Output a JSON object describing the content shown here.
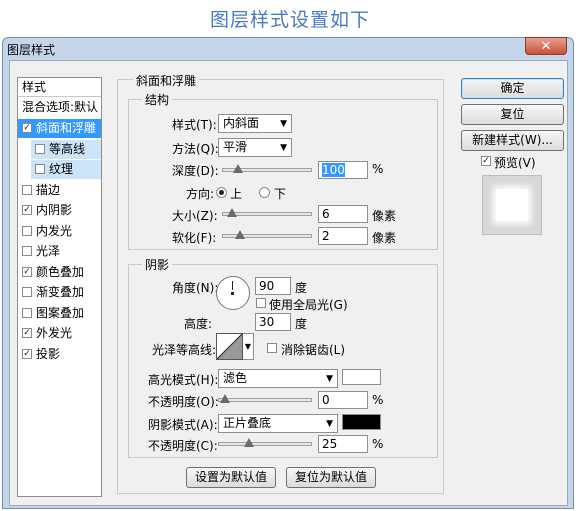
{
  "banner": {
    "text": "图层样式设置如下"
  },
  "window": {
    "title": "图层样式",
    "close_symbol": "✕"
  },
  "left_panel": {
    "header": "样式",
    "blend": "混合选项:默认",
    "items": [
      {
        "label": "斜面和浮雕",
        "checked": true,
        "selected": true,
        "sub": false
      },
      {
        "label": "等高线",
        "checked": false,
        "selected": false,
        "sub": true
      },
      {
        "label": "纹理",
        "checked": false,
        "selected": false,
        "sub": true
      },
      {
        "label": "描边",
        "checked": false,
        "selected": false,
        "sub": false
      },
      {
        "label": "内阴影",
        "checked": true,
        "selected": false,
        "sub": false
      },
      {
        "label": "内发光",
        "checked": false,
        "selected": false,
        "sub": false
      },
      {
        "label": "光泽",
        "checked": false,
        "selected": false,
        "sub": false
      },
      {
        "label": "颜色叠加",
        "checked": true,
        "selected": false,
        "sub": false
      },
      {
        "label": "渐变叠加",
        "checked": false,
        "selected": false,
        "sub": false
      },
      {
        "label": "图案叠加",
        "checked": false,
        "selected": false,
        "sub": false
      },
      {
        "label": "外发光",
        "checked": true,
        "selected": false,
        "sub": false
      },
      {
        "label": "投影",
        "checked": true,
        "selected": false,
        "sub": false
      }
    ]
  },
  "bevel": {
    "title": "斜面和浮雕",
    "structure": {
      "title": "结构",
      "style_label": "样式(T):",
      "style_value": "内斜面",
      "method_label": "方法(Q):",
      "method_value": "平滑",
      "depth_label": "深度(D):",
      "depth_value": "100",
      "depth_unit": "%",
      "depth_fraction": 0.1,
      "direction_label": "方向:",
      "dir_up": "上",
      "dir_down": "下",
      "direction_selected": "上",
      "size_label": "大小(Z):",
      "size_value": "6",
      "size_unit": "像素",
      "size_fraction": 0.03,
      "soften_label": "软化(F):",
      "soften_value": "2",
      "soften_unit": "像素",
      "soften_fraction": 0.12
    },
    "shading": {
      "title": "阴影",
      "angle_label": "角度(N):",
      "angle_value": "90",
      "angle_unit": "度",
      "global_light_label": "使用全局光(G)",
      "global_light_checked": false,
      "altitude_label": "高度:",
      "altitude_value": "30",
      "altitude_unit": "度",
      "gloss_label": "光泽等高线:",
      "antialias_label": "消除锯齿(L)",
      "antialias_checked": false,
      "highlight_mode_label": "高光模式(H):",
      "highlight_mode_value": "滤色",
      "highlight_color": "#ffffff",
      "highlight_opacity_label": "不透明度(O):",
      "highlight_opacity_value": "0",
      "highlight_opacity_unit": "%",
      "highlight_opacity_fraction": 0.0,
      "shadow_mode_label": "阴影模式(A):",
      "shadow_mode_value": "正片叠底",
      "shadow_color": "#000000",
      "shadow_opacity_label": "不透明度(C):",
      "shadow_opacity_value": "25",
      "shadow_opacity_unit": "%",
      "shadow_opacity_fraction": 0.25
    },
    "make_default": "设置为默认值",
    "reset_default": "复位为默认值"
  },
  "right_buttons": {
    "ok": "确定",
    "reset": "复位",
    "new_style": "新建样式(W)...",
    "preview": "预览(V)",
    "preview_checked": true
  }
}
